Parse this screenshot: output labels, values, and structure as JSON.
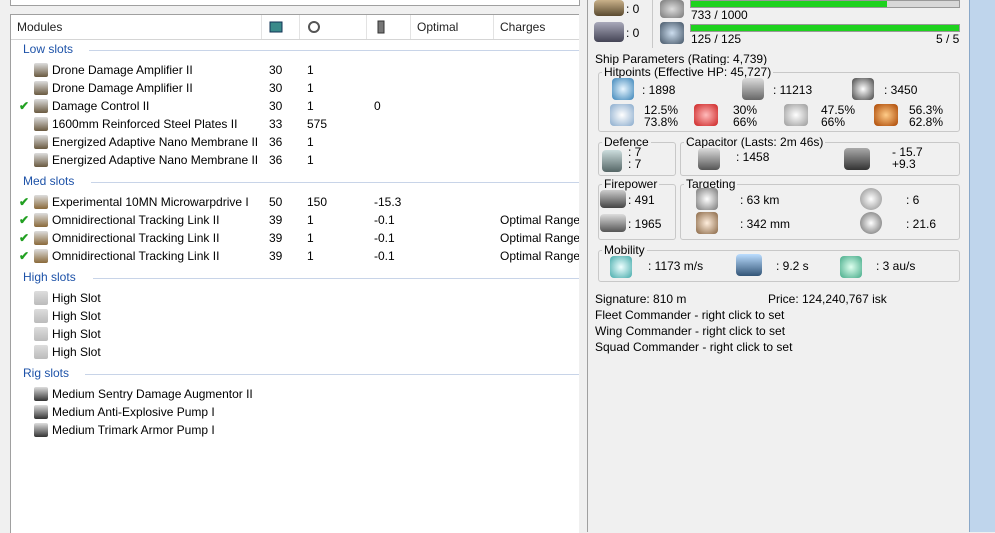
{
  "header": {
    "col_modules": "Modules",
    "col_optimal": "Optimal",
    "col_charges": "Charges",
    "col1_icon": "cpu-icon",
    "col2_icon": "powergrid-icon",
    "col3_icon": "capacitor-icon"
  },
  "sections": {
    "low": "Low slots",
    "med": "Med slots",
    "high": "High slots",
    "rig": "Rig slots"
  },
  "low": [
    {
      "name": "Drone Damage Amplifier II",
      "c1": "30",
      "c2": "1",
      "c3": "",
      "charge": "",
      "checked": false
    },
    {
      "name": "Drone Damage Amplifier II",
      "c1": "30",
      "c2": "1",
      "c3": "",
      "charge": "",
      "checked": false
    },
    {
      "name": "Damage Control II",
      "c1": "30",
      "c2": "1",
      "c3": "0",
      "charge": "",
      "checked": true
    },
    {
      "name": "1600mm Reinforced Steel Plates II",
      "c1": "33",
      "c2": "575",
      "c3": "",
      "charge": "",
      "checked": false
    },
    {
      "name": "Energized Adaptive Nano Membrane II",
      "c1": "36",
      "c2": "1",
      "c3": "",
      "charge": "",
      "checked": false
    },
    {
      "name": "Energized Adaptive Nano Membrane II",
      "c1": "36",
      "c2": "1",
      "c3": "",
      "charge": "",
      "checked": false
    }
  ],
  "med": [
    {
      "name": "Experimental 10MN Microwarpdrive I",
      "c1": "50",
      "c2": "150",
      "c3": "-15.3",
      "charge": "",
      "checked": true
    },
    {
      "name": "Omnidirectional Tracking Link II",
      "c1": "39",
      "c2": "1",
      "c3": "-0.1",
      "charge": "Optimal Range S",
      "checked": true
    },
    {
      "name": "Omnidirectional Tracking Link II",
      "c1": "39",
      "c2": "1",
      "c3": "-0.1",
      "charge": "Optimal Range S",
      "checked": true
    },
    {
      "name": "Omnidirectional Tracking Link II",
      "c1": "39",
      "c2": "1",
      "c3": "-0.1",
      "charge": "Optimal Range S",
      "checked": true
    }
  ],
  "high": [
    {
      "name": "High Slot"
    },
    {
      "name": "High Slot"
    },
    {
      "name": "High Slot"
    },
    {
      "name": "High Slot"
    }
  ],
  "rig": [
    {
      "name": "Medium Sentry Damage Augmentor II"
    },
    {
      "name": "Medium Anti-Explosive Pump I"
    },
    {
      "name": "Medium Trimark Armor Pump I"
    }
  ],
  "top": {
    "launchers": ": 0",
    "turrets": ": 0",
    "drone_bay": "733 / 1000",
    "bandwidth": "125 / 125",
    "drones_active": "5 / 5",
    "drone_bay_fill": 0.733,
    "bandwidth_fill": 1.0
  },
  "params": {
    "title": "Ship Parameters (Rating: 4,739)",
    "hitpoints_title": "Hitpoints (Effective HP: 45,727)",
    "shield_hp": ": 1898",
    "armor_hp": ": 11213",
    "hull_hp": ": 3450",
    "res_em": "12.5%",
    "res_em2": "73.8%",
    "res_th": "30%",
    "res_th2": "66%",
    "res_kin": "47.5%",
    "res_kin2": "66%",
    "res_exp": "56.3%",
    "res_exp2": "62.8%",
    "defence_title": "Defence",
    "def1": ": 7",
    "def2": ": 7",
    "capacitor_title": "Capacitor (Lasts: 2m 46s)",
    "cap": ": 1458",
    "cap_delta1": "- 15.7",
    "cap_delta2": "+9.3",
    "firepower_title": "Firepower",
    "fp1": ": 491",
    "fp2": ": 1965",
    "targeting_title": "Targeting",
    "range": ": 63 km",
    "res": ": 342 mm",
    "targets": ": 6",
    "sensor": ": 21.6",
    "mobility_title": "Mobility",
    "speed": ": 1173 m/s",
    "align": ": 9.2 s",
    "warp": ": 3 au/s",
    "signature": "Signature: 810 m",
    "price": "Price: 124,240,767 isk",
    "fleet": "Fleet Commander - right click to set",
    "wing": "Wing Commander - right click to set",
    "squad": "Squad Commander - right click to set"
  }
}
